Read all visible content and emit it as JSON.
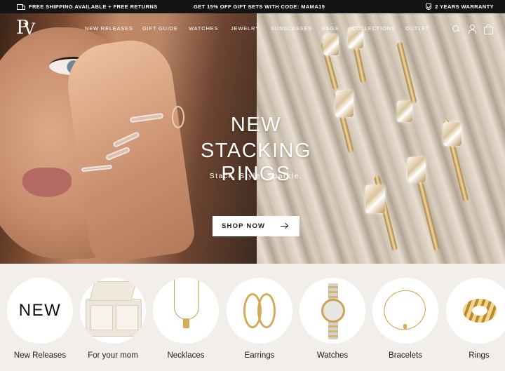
{
  "announcement": {
    "left": "FREE SHIPPING AVAILABLE + FREE RETURNS",
    "center": "GET 15% OFF GIFT SETS WITH CODE: MAMA15",
    "right": "2 YEARS WARRANTY"
  },
  "nav": {
    "items": [
      "NEW RELEASES",
      "GIFT GUIDE",
      "WATCHES",
      "JEWELRY",
      "SUNGLASSES",
      "BAGS",
      "COLLECTIONS",
      "OUTLET"
    ]
  },
  "hero": {
    "title_line1": "NEW",
    "title_line2": "STACKING RINGS",
    "subtitle": "Stack. Style. Sparkle.",
    "cta": "SHOP NOW"
  },
  "categories": {
    "new_badge": "NEW",
    "items": [
      {
        "label": "New Releases",
        "icon": "new-text"
      },
      {
        "label": "For your mom",
        "icon": "gift-box"
      },
      {
        "label": "Necklaces",
        "icon": "necklace"
      },
      {
        "label": "Earrings",
        "icon": "hoop-earrings"
      },
      {
        "label": "Watches",
        "icon": "watch"
      },
      {
        "label": "Bracelets",
        "icon": "bracelet"
      },
      {
        "label": "Rings",
        "icon": "ring"
      }
    ]
  },
  "colors": {
    "topbar_bg": "#141414",
    "page_bg": "#f2efea",
    "accent_gold": "#c9a14b"
  }
}
